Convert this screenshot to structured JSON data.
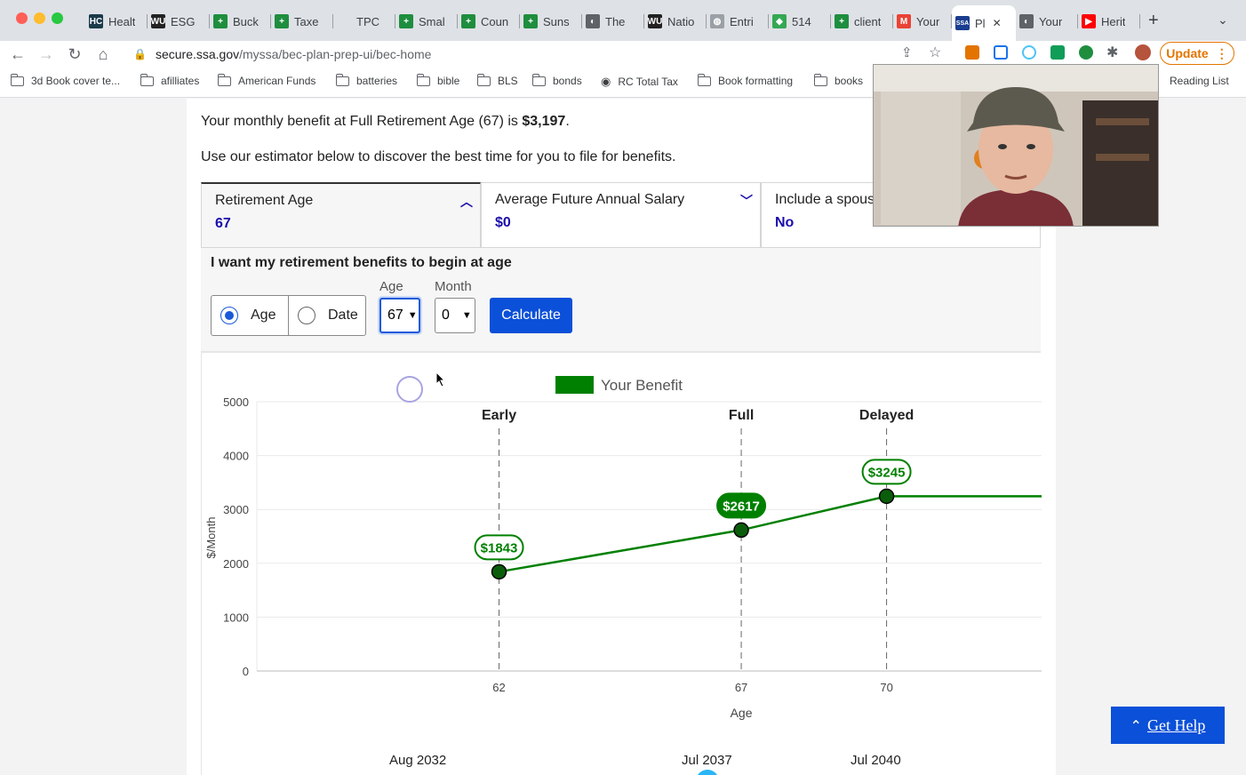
{
  "browser": {
    "tabs": [
      {
        "label": "Healt",
        "fav": "HC",
        "color": "#1b3a4b"
      },
      {
        "label": "ESG",
        "fav": "WU",
        "color": "#222222"
      },
      {
        "label": "Buck",
        "fav": "+",
        "color": "#1e8e3e"
      },
      {
        "label": "Taxe",
        "fav": "+",
        "color": "#1e8e3e"
      },
      {
        "label": "TPC",
        "fav": "",
        "color": "#dee1e6"
      },
      {
        "label": "Smal",
        "fav": "+",
        "color": "#1e8e3e"
      },
      {
        "label": "Coun",
        "fav": "+",
        "color": "#1e8e3e"
      },
      {
        "label": "Suns",
        "fav": "+",
        "color": "#1e8e3e"
      },
      {
        "label": "The",
        "fav": "◐",
        "color": "#5f6368"
      },
      {
        "label": "Natio",
        "fav": "WU",
        "color": "#222222"
      },
      {
        "label": "Entri",
        "fav": "◍",
        "color": "#9aa0a6"
      },
      {
        "label": "514",
        "fav": "◆",
        "color": "#34a853"
      },
      {
        "label": "client",
        "fav": "+",
        "color": "#1e8e3e"
      },
      {
        "label": "Your",
        "fav": "M",
        "color": "#ea4335"
      },
      {
        "label": "Pl",
        "fav": "SSA",
        "color": "#1a3d8f",
        "active": true
      },
      {
        "label": "Your",
        "fav": "◐",
        "color": "#5f6368"
      },
      {
        "label": "Herit",
        "fav": "▶",
        "color": "#ff0000"
      }
    ],
    "url_host": "secure.ssa.gov",
    "url_path": "/myssa/bec-plan-prep-ui/bec-home",
    "update_label": "Update",
    "bookmarks": [
      {
        "label": "3d Book cover te...",
        "icon": "folder-icon"
      },
      {
        "label": "afilliates",
        "icon": "folder-icon"
      },
      {
        "label": "American Funds",
        "icon": "folder-icon"
      },
      {
        "label": "batteries",
        "icon": "folder-icon"
      },
      {
        "label": "bible",
        "icon": "folder-icon"
      },
      {
        "label": "BLS",
        "icon": "folder-icon"
      },
      {
        "label": "bonds",
        "icon": "folder-icon"
      },
      {
        "label": "RC Total Tax",
        "icon": "globe-icon"
      },
      {
        "label": "Book formatting",
        "icon": "folder-icon"
      },
      {
        "label": "books",
        "icon": "folder-icon"
      }
    ],
    "reading_list": "Reading List"
  },
  "page": {
    "benefit_prefix": "Your monthly benefit at Full Retirement Age (67) is ",
    "benefit_amount": "$3,197",
    "benefit_suffix": ".",
    "estimator_text": "Use our estimator below to discover the best time for you to file for benefits.",
    "accordion": [
      {
        "label": "Retirement Age",
        "value": "67",
        "chevron": "up"
      },
      {
        "label": "Average Future Annual Salary",
        "value": "$0",
        "chevron": "down"
      },
      {
        "label": "Include a spous",
        "value": "No",
        "chevron": "none"
      }
    ],
    "panel_title": "I want my retirement benefits to begin at age",
    "radio_age": "Age",
    "radio_date": "Date",
    "age_label": "Age",
    "age_value": "67",
    "month_label": "Month",
    "month_value": "0",
    "calculate_label": "Calculate",
    "help_label": "Get Help",
    "bottom_dates": [
      "Aug 2032",
      "Jul 2037",
      "Jul 2040"
    ]
  },
  "chart_data": {
    "type": "line",
    "legend": "Your Benefit",
    "series_color": "#008000",
    "ylabel": "$/Month",
    "xlabel": "Age",
    "ylim": [
      0,
      5000
    ],
    "yticks": [
      0,
      1000,
      2000,
      3000,
      4000,
      5000
    ],
    "xlim": [
      57,
      73.2
    ],
    "x": [
      62,
      67,
      70
    ],
    "values": [
      1843,
      2617,
      3245
    ],
    "labels": [
      "$1843",
      "$2617",
      "$3245"
    ],
    "markers": [
      {
        "x": 62,
        "label": "Early"
      },
      {
        "x": 67,
        "label": "Full"
      },
      {
        "x": 70,
        "label": "Delayed"
      }
    ],
    "highlight_index": 1
  }
}
